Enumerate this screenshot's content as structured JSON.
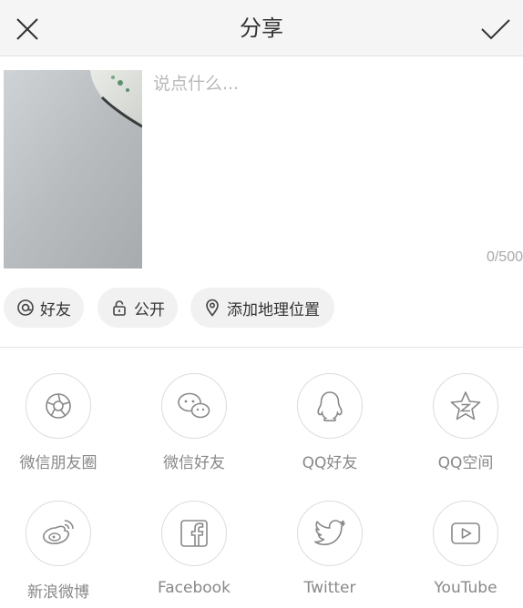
{
  "header": {
    "title": "分享",
    "close_icon": "close-icon",
    "confirm_icon": "checkmark-icon"
  },
  "compose": {
    "placeholder": "说点什么...",
    "value": "",
    "counter": "0/500"
  },
  "chips": [
    {
      "label": "好友",
      "icon": "at-icon"
    },
    {
      "label": "公开",
      "icon": "lock-icon"
    },
    {
      "label": "添加地理位置",
      "icon": "location-pin-icon"
    }
  ],
  "share_targets": [
    {
      "label": "微信朋友圈",
      "icon": "wechat-moments-icon"
    },
    {
      "label": "微信好友",
      "icon": "wechat-icon"
    },
    {
      "label": "QQ好友",
      "icon": "qq-icon"
    },
    {
      "label": "QQ空间",
      "icon": "qzone-icon"
    },
    {
      "label": "新浪微博",
      "icon": "weibo-icon"
    },
    {
      "label": "Facebook",
      "icon": "facebook-icon"
    },
    {
      "label": "Twitter",
      "icon": "twitter-icon"
    },
    {
      "label": "YouTube",
      "icon": "youtube-icon"
    }
  ],
  "colors": {
    "header_bg": "#f5f5f5",
    "chip_bg": "#f1f1f1",
    "icon_stroke": "#888888",
    "label_text": "#888888"
  }
}
